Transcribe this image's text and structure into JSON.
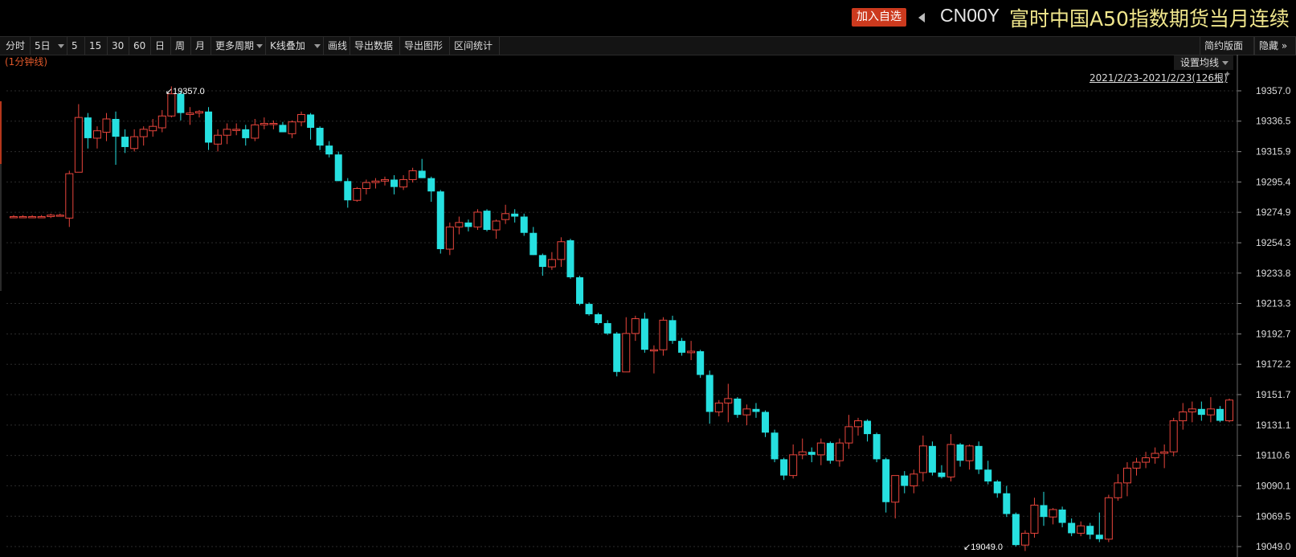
{
  "header": {
    "add_watchlist": "加入自选",
    "code": "CN00Y",
    "product": "富时中国A50指数期货当月连续"
  },
  "toolbar": {
    "left": [
      {
        "label": "分时",
        "caret": false
      },
      {
        "label": "5日",
        "caret": true
      },
      {
        "label": "5",
        "caret": false
      },
      {
        "label": "15",
        "caret": false
      },
      {
        "label": "30",
        "caret": false
      },
      {
        "label": "60",
        "caret": false
      },
      {
        "label": "日",
        "caret": false
      },
      {
        "label": "周",
        "caret": false
      },
      {
        "label": "月",
        "caret": false
      },
      {
        "label": "更多周期",
        "caret": true
      },
      {
        "label": "K线叠加",
        "caret": true
      },
      {
        "label": "画线",
        "caret": false
      },
      {
        "label": "导出数据",
        "caret": false
      },
      {
        "label": "导出图形",
        "caret": false
      },
      {
        "label": "区间统计",
        "caret": false
      }
    ],
    "right": [
      {
        "label": "简约版面"
      },
      {
        "label": "隐藏 »"
      }
    ]
  },
  "chart_panel": {
    "interval_label": "(1分钟线)",
    "ma_settings_label": "设置均线",
    "range_label": "2021/2/23-2021/2/23(126根)"
  },
  "colors": {
    "up": "#e8453c",
    "down": "#26e0e0",
    "background": "#000000",
    "grid": "#2c2c2c",
    "axis_text": "#dddddd",
    "marker_text": "#ffffff"
  },
  "chart_data": {
    "type": "candlestick",
    "ylim": [
      19045,
      19365
    ],
    "y_ticks": [
      "19357.0",
      "19336.5",
      "19315.9",
      "19295.4",
      "19274.9",
      "19254.3",
      "19233.8",
      "19213.3",
      "19192.7",
      "19172.2",
      "19151.7",
      "19131.1",
      "19110.6",
      "19090.1",
      "19069.5",
      "19049.0"
    ],
    "max_marker": {
      "index": 16,
      "value": 19357.0,
      "label": "19357.0"
    },
    "min_marker": {
      "index": 102,
      "value": 19049.0,
      "label": "19049.0"
    },
    "candles": [
      [
        19272,
        19273,
        19271,
        19272
      ],
      [
        19272,
        19273,
        19271,
        19272
      ],
      [
        19272,
        19273,
        19271,
        19272
      ],
      [
        19272,
        19273,
        19271,
        19272
      ],
      [
        19272,
        19274,
        19271,
        19273
      ],
      [
        19273,
        19274,
        19272,
        19273
      ],
      [
        19271,
        19303,
        19265,
        19301
      ],
      [
        19302,
        19348,
        19302,
        19339
      ],
      [
        19339,
        19342,
        19318,
        19325
      ],
      [
        19325,
        19333,
        19318,
        19330
      ],
      [
        19329,
        19342,
        19323,
        19338
      ],
      [
        19338,
        19343,
        19307,
        19326
      ],
      [
        19326,
        19331,
        19315,
        19319
      ],
      [
        19318,
        19331,
        19316,
        19326
      ],
      [
        19326,
        19333,
        19320,
        19331
      ],
      [
        19330,
        19338,
        19326,
        19333
      ],
      [
        19332,
        19344,
        19329,
        19340
      ],
      [
        19340,
        19360,
        19339,
        19355
      ],
      [
        19355,
        19357,
        19337,
        19342
      ],
      [
        19341,
        19346,
        19334,
        19342
      ],
      [
        19342,
        19344,
        19339,
        19343
      ],
      [
        19343,
        19346,
        19317,
        19322
      ],
      [
        19321,
        19331,
        19316,
        19327
      ],
      [
        19327,
        19335,
        19321,
        19331
      ],
      [
        19331,
        19335,
        19327,
        19331
      ],
      [
        19331,
        19334,
        19320,
        19325
      ],
      [
        19325,
        19338,
        19323,
        19334
      ],
      [
        19334,
        19339,
        19331,
        19335
      ],
      [
        19335,
        19337,
        19331,
        19335
      ],
      [
        19334,
        19336,
        19330,
        19329
      ],
      [
        19328,
        19337,
        19325,
        19336
      ],
      [
        19336,
        19343,
        19333,
        19341
      ],
      [
        19341,
        19342,
        19324,
        19332
      ],
      [
        19332,
        19333,
        19317,
        19320
      ],
      [
        19320,
        19323,
        19312,
        19314
      ],
      [
        19314,
        19316,
        19296,
        19296
      ],
      [
        19296,
        19298,
        19278,
        19283
      ],
      [
        19283,
        19292,
        19282,
        19291
      ],
      [
        19291,
        19297,
        19287,
        19295
      ],
      [
        19295,
        19298,
        19291,
        19296
      ],
      [
        19296,
        19299,
        19293,
        19297
      ],
      [
        19297,
        19300,
        19287,
        19292
      ],
      [
        19292,
        19300,
        19290,
        19297
      ],
      [
        19297,
        19305,
        19295,
        19303
      ],
      [
        19303,
        19311,
        19298,
        19298
      ],
      [
        19298,
        19299,
        19282,
        19289
      ],
      [
        19289,
        19290,
        19247,
        19250
      ],
      [
        19250,
        19268,
        19246,
        19265
      ],
      [
        19265,
        19272,
        19260,
        19268
      ],
      [
        19268,
        19270,
        19262,
        19265
      ],
      [
        19265,
        19277,
        19263,
        19275
      ],
      [
        19276,
        19277,
        19262,
        19263
      ],
      [
        19263,
        19270,
        19257,
        19269
      ],
      [
        19270,
        19280,
        19267,
        19274
      ],
      [
        19274,
        19277,
        19268,
        19272
      ],
      [
        19272,
        19274,
        19259,
        19261
      ],
      [
        19261,
        19265,
        19246,
        19246
      ],
      [
        19246,
        19247,
        19232,
        19238
      ],
      [
        19238,
        19248,
        19236,
        19243
      ],
      [
        19243,
        19258,
        19238,
        19255
      ],
      [
        19256,
        19257,
        19230,
        19231
      ],
      [
        19231,
        19232,
        19212,
        19213
      ],
      [
        19213,
        19214,
        19205,
        19206
      ],
      [
        19206,
        19207,
        19199,
        19200
      ],
      [
        19200,
        19202,
        19192,
        19193
      ],
      [
        19193,
        19194,
        19164,
        19167
      ],
      [
        19167,
        19204,
        19167,
        19193
      ],
      [
        19193,
        19205,
        19188,
        19203
      ],
      [
        19203,
        19207,
        19180,
        19182
      ],
      [
        19182,
        19185,
        19166,
        19182
      ],
      [
        19182,
        19204,
        19178,
        19202
      ],
      [
        19202,
        19205,
        19186,
        19188
      ],
      [
        19188,
        19190,
        19178,
        19180
      ],
      [
        19180,
        19188,
        19175,
        19181
      ],
      [
        19181,
        19182,
        19163,
        19165
      ],
      [
        19165,
        19168,
        19132,
        19140
      ],
      [
        19140,
        19148,
        19137,
        19146
      ],
      [
        19146,
        19159,
        19133,
        19149
      ],
      [
        19149,
        19150,
        19136,
        19138
      ],
      [
        19138,
        19145,
        19131,
        19142
      ],
      [
        19142,
        19146,
        19136,
        19140
      ],
      [
        19140,
        19141,
        19123,
        19126
      ],
      [
        19126,
        19128,
        19106,
        19108
      ],
      [
        19108,
        19109,
        19094,
        19097
      ],
      [
        19097,
        19118,
        19095,
        19111
      ],
      [
        19111,
        19122,
        19108,
        19113
      ],
      [
        19113,
        19116,
        19106,
        19111
      ],
      [
        19111,
        19122,
        19104,
        19119
      ],
      [
        19119,
        19120,
        19105,
        19107
      ],
      [
        19107,
        19122,
        19103,
        19119
      ],
      [
        19119,
        19138,
        19115,
        19130
      ],
      [
        19130,
        19136,
        19124,
        19134
      ],
      [
        19134,
        19135,
        19120,
        19125
      ],
      [
        19125,
        19126,
        19106,
        19108
      ],
      [
        19108,
        19109,
        19072,
        19079
      ],
      [
        19079,
        19087,
        19068,
        19097
      ],
      [
        19097,
        19100,
        19085,
        19090
      ],
      [
        19090,
        19101,
        19085,
        19098
      ],
      [
        19099,
        19124,
        19093,
        19117
      ],
      [
        19117,
        19120,
        19097,
        19099
      ],
      [
        19099,
        19104,
        19095,
        19096
      ],
      [
        19096,
        19125,
        19093,
        19118
      ],
      [
        19118,
        19119,
        19103,
        19107
      ],
      [
        19107,
        19118,
        19101,
        19117
      ],
      [
        19117,
        19120,
        19098,
        19101
      ],
      [
        19101,
        19107,
        19091,
        19093
      ],
      [
        19093,
        19094,
        19082,
        19085
      ],
      [
        19085,
        19090,
        19069,
        19071
      ],
      [
        19071,
        19072,
        19049,
        19050
      ],
      [
        19050,
        19060,
        19046,
        19058
      ],
      [
        19058,
        19082,
        19055,
        19077
      ],
      [
        19077,
        19086,
        19063,
        19069
      ],
      [
        19069,
        19075,
        19064,
        19074
      ],
      [
        19074,
        19076,
        19062,
        19065
      ],
      [
        19065,
        19068,
        19056,
        19058
      ],
      [
        19058,
        19066,
        19056,
        19063
      ],
      [
        19063,
        19065,
        19054,
        19057
      ],
      [
        19057,
        19072,
        19052,
        19054
      ],
      [
        19054,
        19084,
        19052,
        19082
      ],
      [
        19082,
        19098,
        19080,
        19092
      ],
      [
        19092,
        19106,
        19083,
        19102
      ],
      [
        19102,
        19109,
        19097,
        19106
      ],
      [
        19106,
        19113,
        19102,
        19109
      ],
      [
        19109,
        19116,
        19105,
        19112
      ],
      [
        19112,
        19118,
        19102,
        19113
      ],
      [
        19113,
        19136,
        19110,
        19134
      ],
      [
        19134,
        19146,
        19128,
        19140
      ],
      [
        19140,
        19147,
        19133,
        19142
      ],
      [
        19142,
        19147,
        19134,
        19138
      ],
      [
        19138,
        19150,
        19133,
        19142
      ],
      [
        19142,
        19144,
        19133,
        19134
      ],
      [
        19134,
        19149,
        19133,
        19148
      ]
    ]
  }
}
